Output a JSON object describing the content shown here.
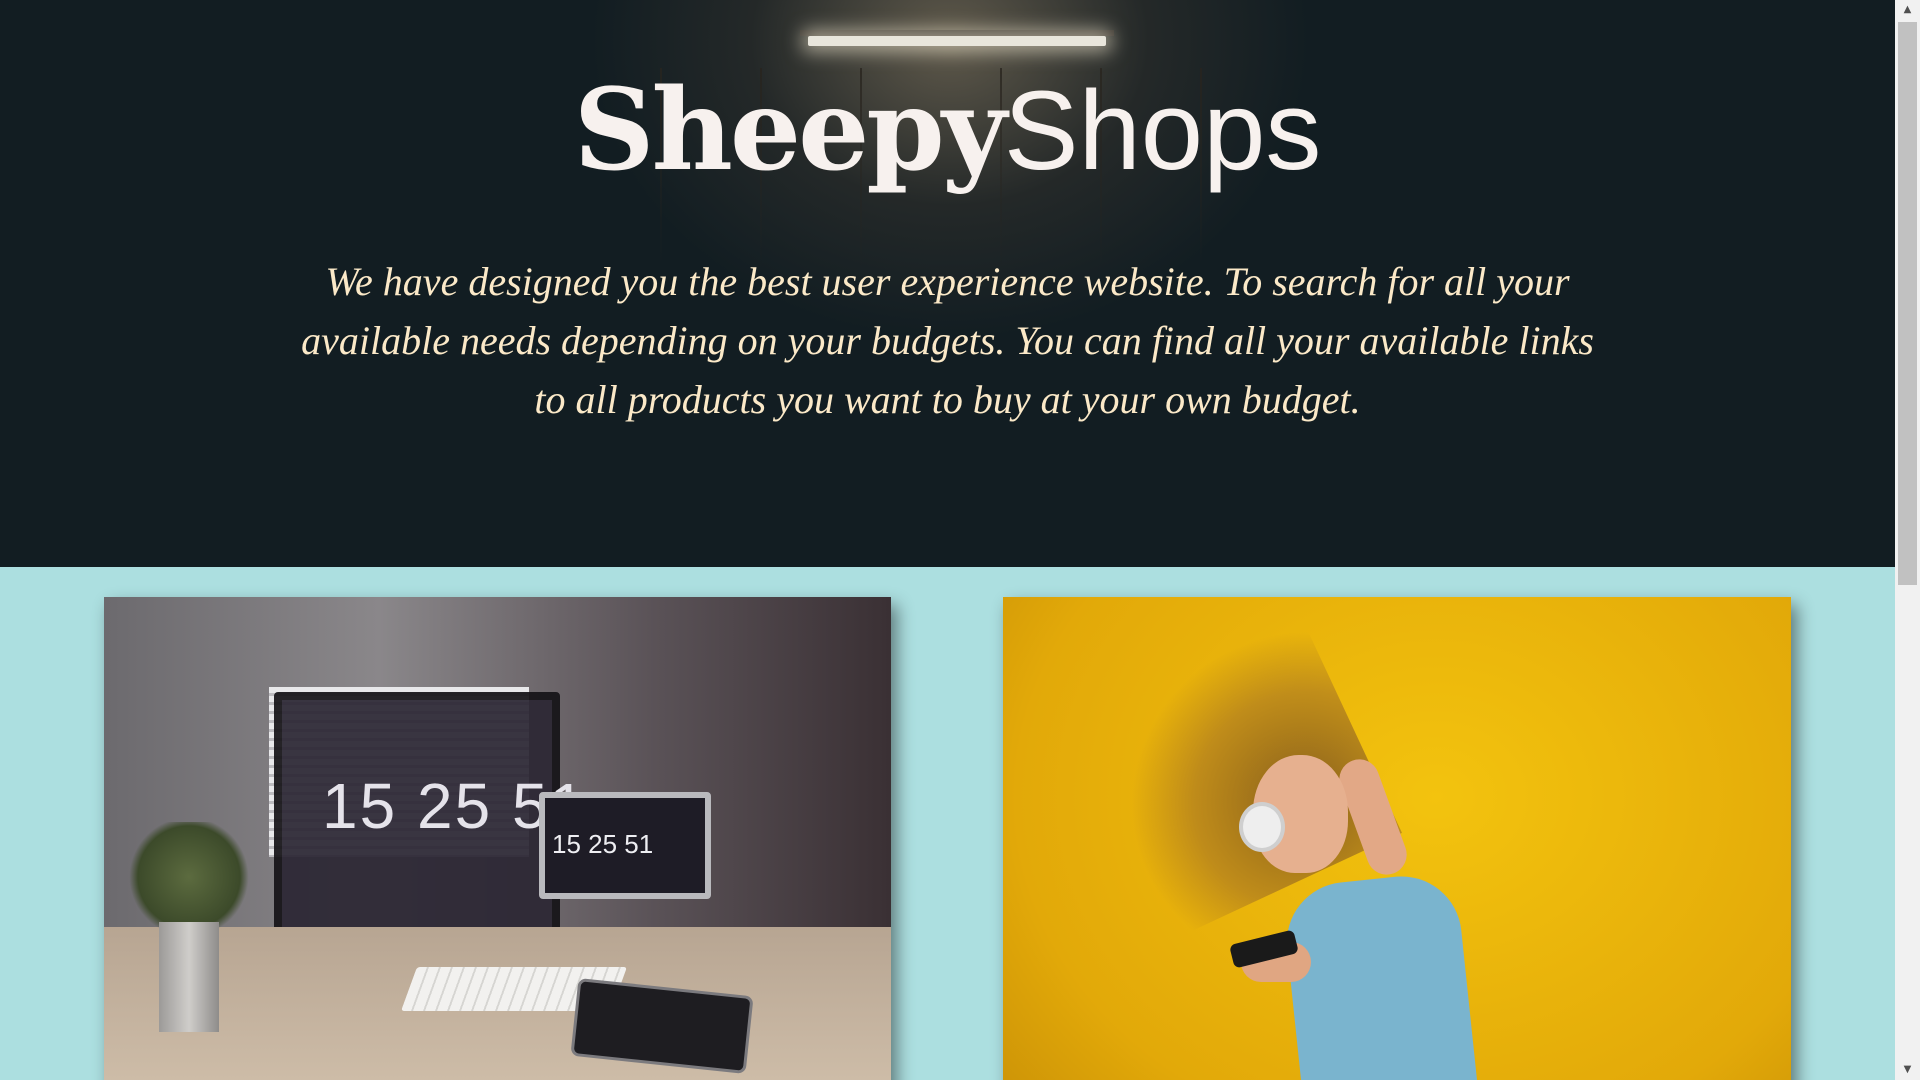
{
  "hero": {
    "logo_bold": "Sheepy",
    "logo_light": "Shops",
    "tagline": "We have designed you the best user experience website. To search for all your available needs depending on your budgets. You can find all your available links to all products you want to buy at your own budget."
  },
  "cards": {
    "desk": {
      "clock_large": "15 25 51",
      "clock_small": "15 25 51"
    },
    "music": {}
  },
  "scrollbar": {
    "up_icon": "arrow-up-icon",
    "down_icon": "arrow-down-icon",
    "up_glyph": "▲",
    "down_glyph": "▼"
  },
  "colors": {
    "hero_background": "#121d22",
    "page_background": "#acdfe0",
    "logo_text": "#f7f1ee",
    "tagline_text": "#fbe9c8"
  }
}
